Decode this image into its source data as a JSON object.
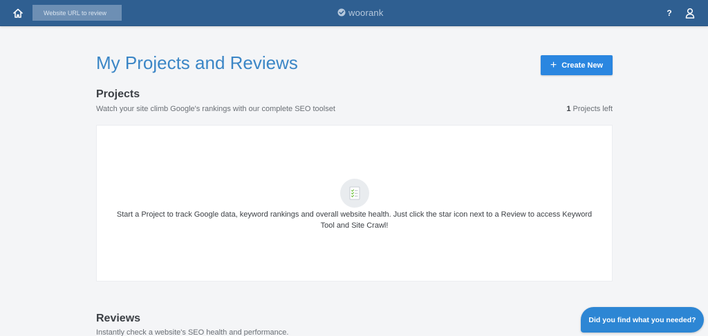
{
  "header": {
    "search_placeholder": "Website URL to review",
    "logo_text": "woorank",
    "help_label": "?"
  },
  "main": {
    "title": "My Projects and Reviews",
    "create_label": "Create New",
    "projects": {
      "title": "Projects",
      "subtitle": "Watch your site climb Google's rankings with our complete SEO toolset",
      "left_count": "1",
      "left_label": "Projects left",
      "empty_message": "Start a Project to track Google data, keyword rankings and overall website health. Just click the star icon next to a Review to access Keyword Tool and Site Crawl!"
    },
    "reviews": {
      "title": "Reviews",
      "subtitle": "Instantly check a website's SEO health and performance."
    }
  },
  "chat": {
    "label": "Did you find what you needed?"
  },
  "colors": {
    "header_bg": "#2f5f91",
    "accent": "#2a86e0",
    "title": "#3b86c6",
    "page_bg": "#f4f5f7"
  },
  "icons": [
    "home-icon",
    "woorank-logo-icon",
    "user-icon",
    "plus-icon",
    "checklist-icon"
  ]
}
